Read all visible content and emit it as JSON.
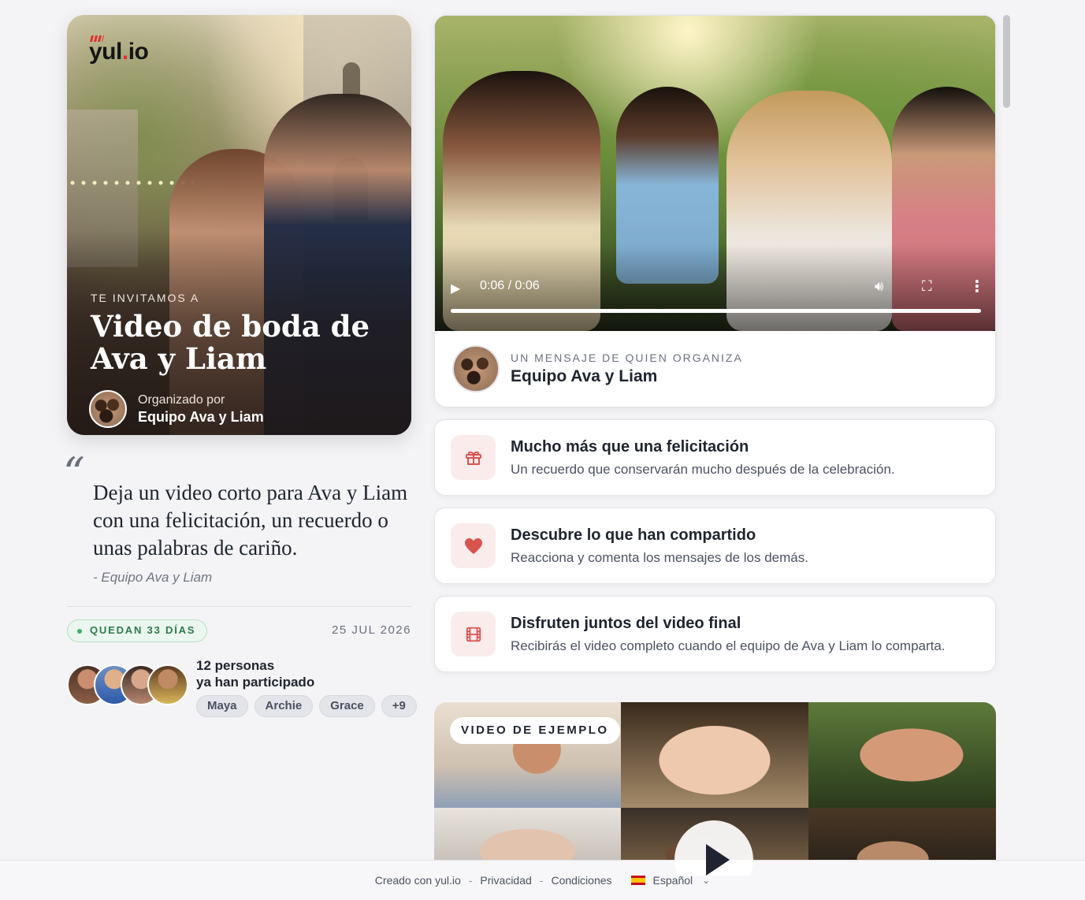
{
  "hero": {
    "logo": "yul.io",
    "eyebrow": "TE INVITAMOS A",
    "title": "Video de boda de Ava y Liam",
    "organizer_label": "Organizado por",
    "organizer_name": "Equipo Ava y Liam"
  },
  "quote": {
    "text": "Deja un video corto para Ava y Liam con una felicitación, un recuerdo o unas palabras de cariño.",
    "author": "- Equipo Ava y Liam"
  },
  "status": {
    "days_left": "QUEDAN 33 DÍAS",
    "date": "25 JUL 2026"
  },
  "participants": {
    "count_line1": "12 personas",
    "count_line2": "ya han participado",
    "names": [
      "Maya",
      "Archie",
      "Grace",
      "+9"
    ]
  },
  "video": {
    "time": "0:06 / 0:06",
    "progress": 1.0
  },
  "host": {
    "label": "UN MENSAJE DE QUIEN ORGANIZA",
    "name": "Equipo Ava y Liam"
  },
  "features": [
    {
      "icon": "gift-icon",
      "title": "Mucho más que una felicitación",
      "desc": "Un recuerdo que conservarán mucho después de la celebración."
    },
    {
      "icon": "heart-icon",
      "title": "Descubre lo que han compartido",
      "desc": "Reacciona y comenta los mensajes de los demás."
    },
    {
      "icon": "film-icon",
      "title": "Disfruten juntos del video final",
      "desc": "Recibirás el video completo cuando el equipo de Ava y Liam lo comparta."
    }
  ],
  "sample": {
    "badge": "VIDEO DE EJEMPLO"
  },
  "footer": {
    "created": "Creado con yul.io",
    "privacy": "Privacidad",
    "terms": "Condiciones",
    "language": "Español",
    "separator": "-"
  },
  "colors": {
    "accent": "#e0312e",
    "feature_icon": "#d9534f",
    "status_green": "#2f7a4b"
  }
}
